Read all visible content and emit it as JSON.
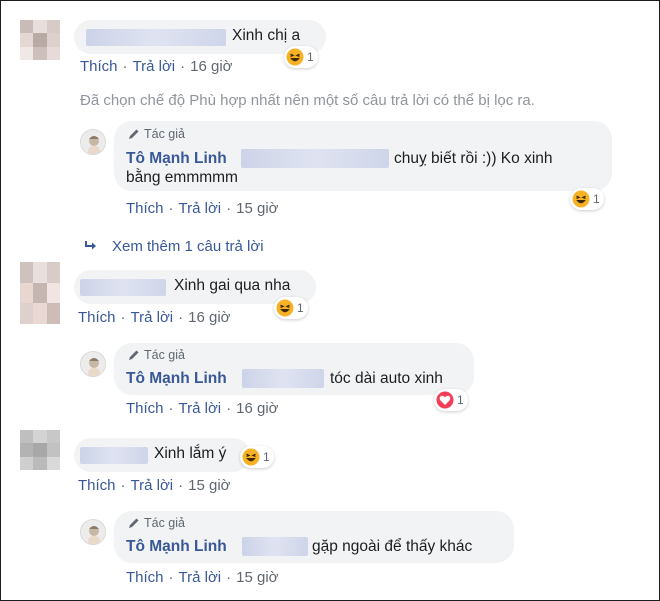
{
  "comments": [
    {
      "text": "Xinh chị a",
      "actions": {
        "like": "Thích",
        "reply": "Trả lời",
        "time": "16 giờ"
      },
      "reaction": {
        "type": "haha-icon",
        "count": "1"
      }
    },
    {
      "text": "Xinh gai qua nha",
      "actions": {
        "like": "Thích",
        "reply": "Trả lời",
        "time": "16 giờ"
      },
      "reaction": {
        "type": "haha-icon",
        "count": "1"
      }
    },
    {
      "text": "Xinh lắm ý",
      "actions": {
        "like": "Thích",
        "reply": "Trả lời",
        "time": "15 giờ"
      },
      "reaction": {
        "type": "haha-icon",
        "count": "1"
      }
    }
  ],
  "filter_notice": "Đã chọn chế độ Phù hợp nhất nên một số câu trả lời có thể bị lọc ra.",
  "view_more": "Xem thêm 1 câu trả lời",
  "author_badge": "Tác giả",
  "replies": [
    {
      "author": "Tô Mạnh Linh",
      "text_line1": "chuỵ biết rồi :)) Ko xinh",
      "text_line2": "bằng emmmmm",
      "actions": {
        "like": "Thích",
        "reply": "Trả lời",
        "time": "15 giờ"
      },
      "reaction": {
        "type": "haha-icon",
        "count": "1"
      }
    },
    {
      "author": "Tô Mạnh Linh",
      "text_line1": "tóc dài auto xinh",
      "actions": {
        "like": "Thích",
        "reply": "Trả lời",
        "time": "16 giờ"
      },
      "reaction": {
        "type": "love-icon",
        "count": "1"
      }
    },
    {
      "author": "Tô Mạnh Linh",
      "text_line1": "gặp ngoài để thấy khác",
      "actions": {
        "like": "Thích",
        "reply": "Trả lời",
        "time": "15 giờ"
      }
    }
  ],
  "colors": {
    "link": "#385898",
    "bubble": "#f2f3f5",
    "meta": "#606770",
    "haha": "#f7b125",
    "love": "#f33e58"
  }
}
